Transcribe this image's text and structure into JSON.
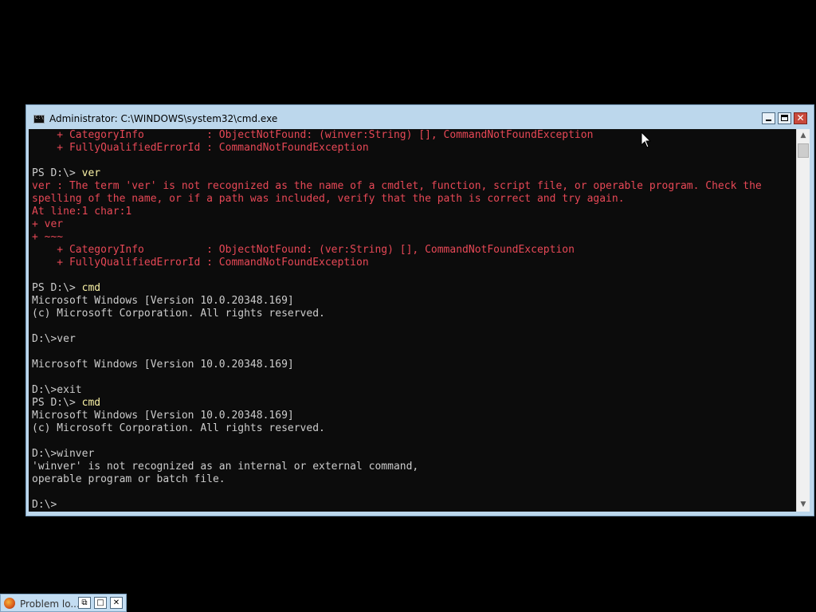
{
  "window": {
    "title": "Administrator: C:\\WINDOWS\\system32\\cmd.exe",
    "app_icon": "cmd-icon",
    "controls": {
      "minimize_icon": "minimize-icon",
      "maximize_icon": "maximize-icon",
      "close_icon": "close-icon",
      "close_glyph": "✕"
    }
  },
  "console": {
    "lines": [
      {
        "text": "    + CategoryInfo          : ObjectNotFound: (winver:String) [], CommandNotFoundException",
        "color": "red"
      },
      {
        "text": "    + FullyQualifiedErrorId : CommandNotFoundException",
        "color": "red"
      },
      {
        "text": "",
        "color": "gray"
      },
      {
        "prompt": "PS D:\\> ",
        "command": "ver",
        "color": "gray"
      },
      {
        "text": "ver : The term 'ver' is not recognized as the name of a cmdlet, function, script file, or operable program. Check the",
        "color": "red"
      },
      {
        "text": "spelling of the name, or if a path was included, verify that the path is correct and try again.",
        "color": "red"
      },
      {
        "text": "At line:1 char:1",
        "color": "red"
      },
      {
        "text": "+ ver",
        "color": "red"
      },
      {
        "text": "+ ~~~",
        "color": "red"
      },
      {
        "text": "    + CategoryInfo          : ObjectNotFound: (ver:String) [], CommandNotFoundException",
        "color": "red"
      },
      {
        "text": "    + FullyQualifiedErrorId : CommandNotFoundException",
        "color": "red"
      },
      {
        "text": "",
        "color": "gray"
      },
      {
        "prompt": "PS D:\\> ",
        "command": "cmd",
        "color": "gray"
      },
      {
        "text": "Microsoft Windows [Version 10.0.20348.169]",
        "color": "gray"
      },
      {
        "text": "(c) Microsoft Corporation. All rights reserved.",
        "color": "gray"
      },
      {
        "text": "",
        "color": "gray"
      },
      {
        "text": "D:\\>ver",
        "color": "gray"
      },
      {
        "text": "",
        "color": "gray"
      },
      {
        "text": "Microsoft Windows [Version 10.0.20348.169]",
        "color": "gray"
      },
      {
        "text": "",
        "color": "gray"
      },
      {
        "text": "D:\\>exit",
        "color": "gray"
      },
      {
        "prompt": "PS D:\\> ",
        "command": "cmd",
        "color": "gray"
      },
      {
        "text": "Microsoft Windows [Version 10.0.20348.169]",
        "color": "gray"
      },
      {
        "text": "(c) Microsoft Corporation. All rights reserved.",
        "color": "gray"
      },
      {
        "text": "",
        "color": "gray"
      },
      {
        "text": "D:\\>winver",
        "color": "gray"
      },
      {
        "text": "'winver' is not recognized as an internal or external command,",
        "color": "gray"
      },
      {
        "text": "operable program or batch file.",
        "color": "gray"
      },
      {
        "text": "",
        "color": "gray"
      },
      {
        "text": "D:\\>",
        "color": "gray"
      }
    ],
    "colors": {
      "background": "#0c0c0c",
      "gray": "#cccccc",
      "red": "#e74856",
      "yellow": "#f9f1a5"
    }
  },
  "scrollbar": {
    "up_icon": "scroll-up-arrow-icon",
    "down_icon": "scroll-down-arrow-icon",
    "up_glyph": "▲",
    "down_glyph": "▼"
  },
  "minimized_window": {
    "label": "Problem lo...",
    "icon": "firefox-icon",
    "restore_glyph": "⧉",
    "maximize_glyph": "□",
    "close_glyph": "✕"
  }
}
